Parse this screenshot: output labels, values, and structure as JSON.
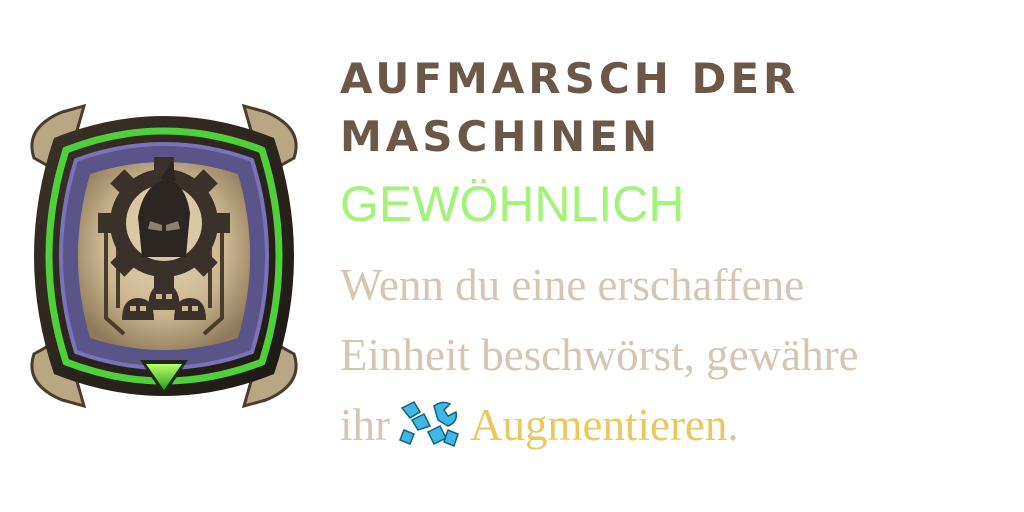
{
  "card": {
    "title_line1": "AUFMARSCH DER",
    "title_line2": "MASCHINEN",
    "rarity": "GEWÖHNLICH",
    "description": {
      "line1": "Wenn du eine erschaffene",
      "line2": "Einheit beschwörst, gewähre",
      "line3_prefix": "ihr",
      "keyword": "Augmentieren",
      "line3_suffix": "."
    },
    "icons": {
      "emblem": "gear-helmet-emblem-icon",
      "rarity_gem": "green-triangle-gem-icon",
      "keyword": "augment-wrench-icon"
    },
    "colors": {
      "title": "#6b5847",
      "rarity": "#a3f37b",
      "description": "#d4c6b3",
      "keyword": "#e9c860",
      "frame_green": "#4fcf3a",
      "keyword_icon": "#3fb8e8"
    }
  }
}
